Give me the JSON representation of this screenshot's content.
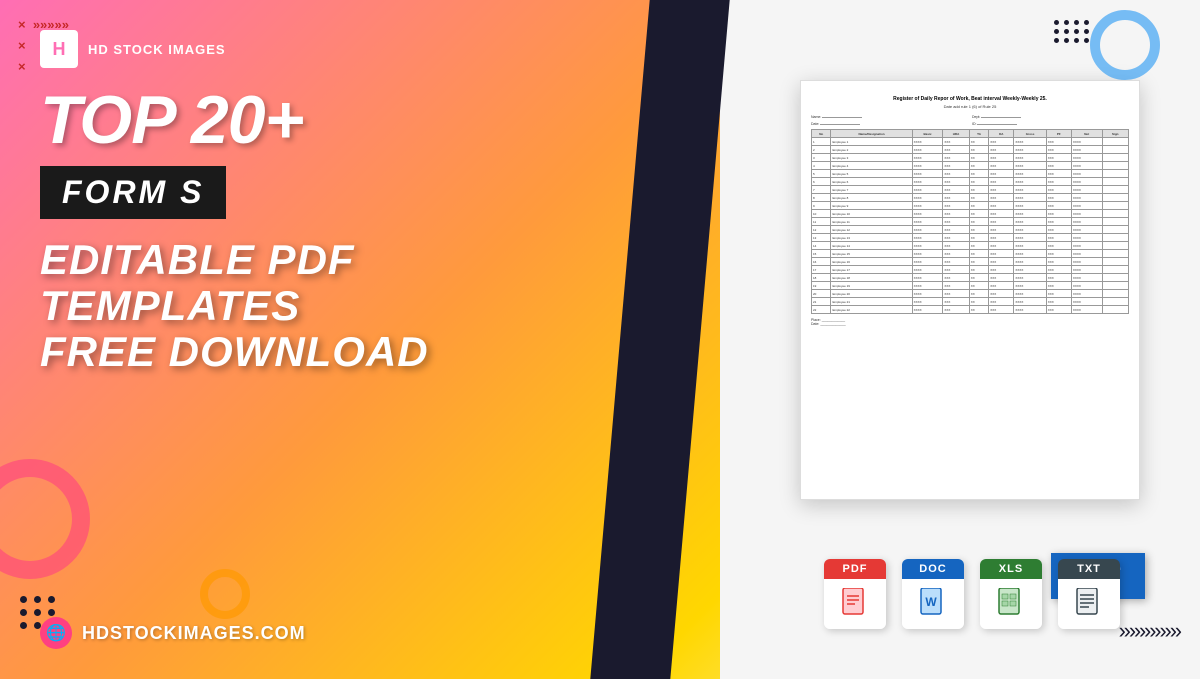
{
  "logo": {
    "icon_text": "H",
    "name": "HD STOCK IMAGES"
  },
  "heading_top": "TOP 20+",
  "badge_text": "FORM S",
  "main_heading_line1": "EDITABLE PDF TEMPLATES",
  "main_heading_line2": "FREE DOWNLOAD",
  "website_url": "HDSTOCKIMAGES.COM",
  "pdf_badge_label": "PDF",
  "format_icons": [
    {
      "type": "PDF",
      "color": "#e53935",
      "symbol": "📄"
    },
    {
      "type": "DOC",
      "color": "#1565c0",
      "symbol": "📝"
    },
    {
      "type": "XLS",
      "color": "#2e7d32",
      "symbol": "📊"
    },
    {
      "type": "TXT",
      "color": "#37474f",
      "symbol": "📋"
    }
  ],
  "doc_preview": {
    "title": "Register of Daily Repor of Work, Beat interval Weekly-Weekly 25.",
    "subtitle": "Date add rule 1 (6) of Rule 25",
    "rows": 25
  },
  "decorations": {
    "x_symbols": [
      "×",
      "»",
      "»",
      "»",
      "»",
      "»"
    ],
    "chevrons": "»»»»»»"
  }
}
